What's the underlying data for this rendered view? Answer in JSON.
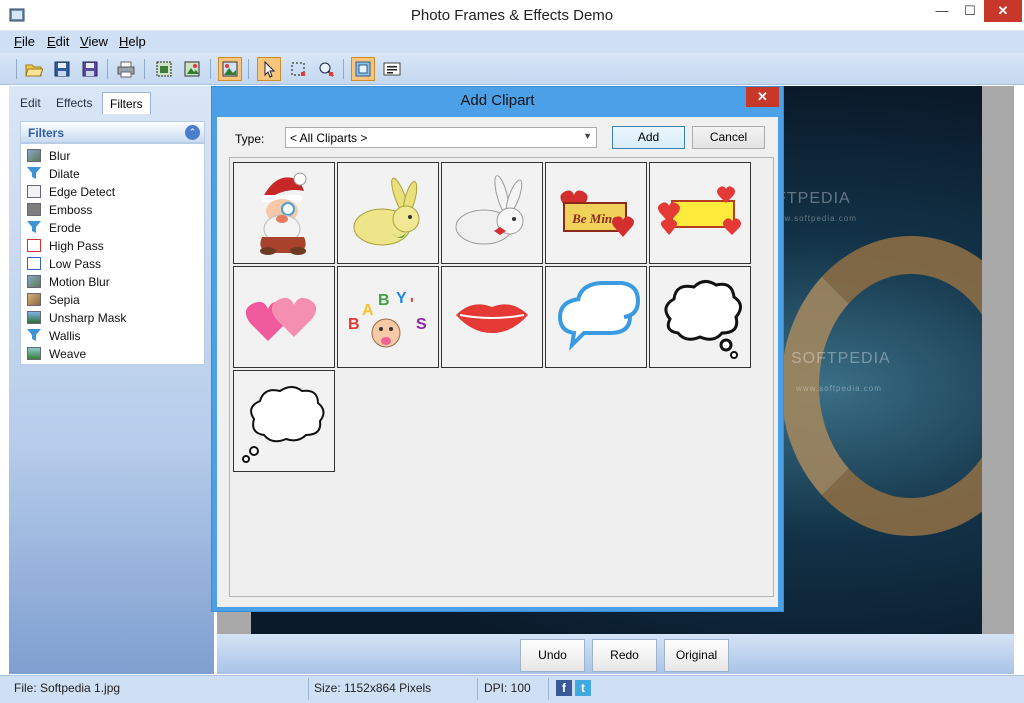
{
  "window": {
    "title": "Photo Frames & Effects Demo",
    "minimize": "—",
    "maximize": "☐",
    "close": "✕"
  },
  "menu": [
    {
      "label": "File",
      "accel": "F",
      "rest": "ile"
    },
    {
      "label": "Edit",
      "accel": "E",
      "rest": "dit"
    },
    {
      "label": "View",
      "accel": "V",
      "rest": "iew"
    },
    {
      "label": "Help",
      "accel": "H",
      "rest": "elp"
    }
  ],
  "toolbar": {
    "buttons": [
      "open-icon",
      "save-icon",
      "save-as-icon",
      "print-icon",
      "crop-icon",
      "resize-icon",
      "add-clipart-icon",
      "select-pointer-icon",
      "rect-select-icon",
      "zoom-icon",
      "frame-icon",
      "text-icon"
    ],
    "active": [
      "add-clipart-icon",
      "select-pointer-icon",
      "frame-icon"
    ]
  },
  "left_panel": {
    "tabs": [
      "Edit",
      "Effects",
      "Filters"
    ],
    "active_tab": "Filters",
    "header": "Filters",
    "collapse_glyph": "⌃",
    "items": [
      "Blur",
      "Dilate",
      "Edge Detect",
      "Emboss",
      "Erode",
      "High Pass",
      "Low Pass",
      "Motion Blur",
      "Sepia",
      "Unsharp Mask",
      "Wallis",
      "Weave"
    ]
  },
  "canvas": {
    "watermarks": [
      "SOFTPEDIA",
      "www.softpedia.com",
      "SOFTPEDIA",
      "www.softpedia.com"
    ]
  },
  "bottom_buttons": {
    "undo": "Undo",
    "redo": "Redo",
    "original": "Original"
  },
  "status": {
    "file": "File: Softpedia 1.jpg",
    "size": "Size: 1152x864 Pixels",
    "dpi": "DPI: 100",
    "facebook": "f",
    "twitter": "t"
  },
  "dialog": {
    "title": "Add Clipart",
    "close": "✕",
    "type_label": "Type:",
    "type_value": "< All Cliparts >",
    "add": "Add",
    "cancel": "Cancel",
    "cliparts": [
      "santa",
      "yellow-bunny",
      "white-bunny",
      "be-mine-sign",
      "hearts-sign",
      "pink-hearts",
      "baby-us",
      "lips",
      "speech-bubbles",
      "thought-bubble-1",
      "thought-bubble-2"
    ],
    "be_mine_text": "Be Mine",
    "baby_letters": [
      "B",
      "A",
      "B",
      "Y",
      "'",
      "S"
    ]
  }
}
